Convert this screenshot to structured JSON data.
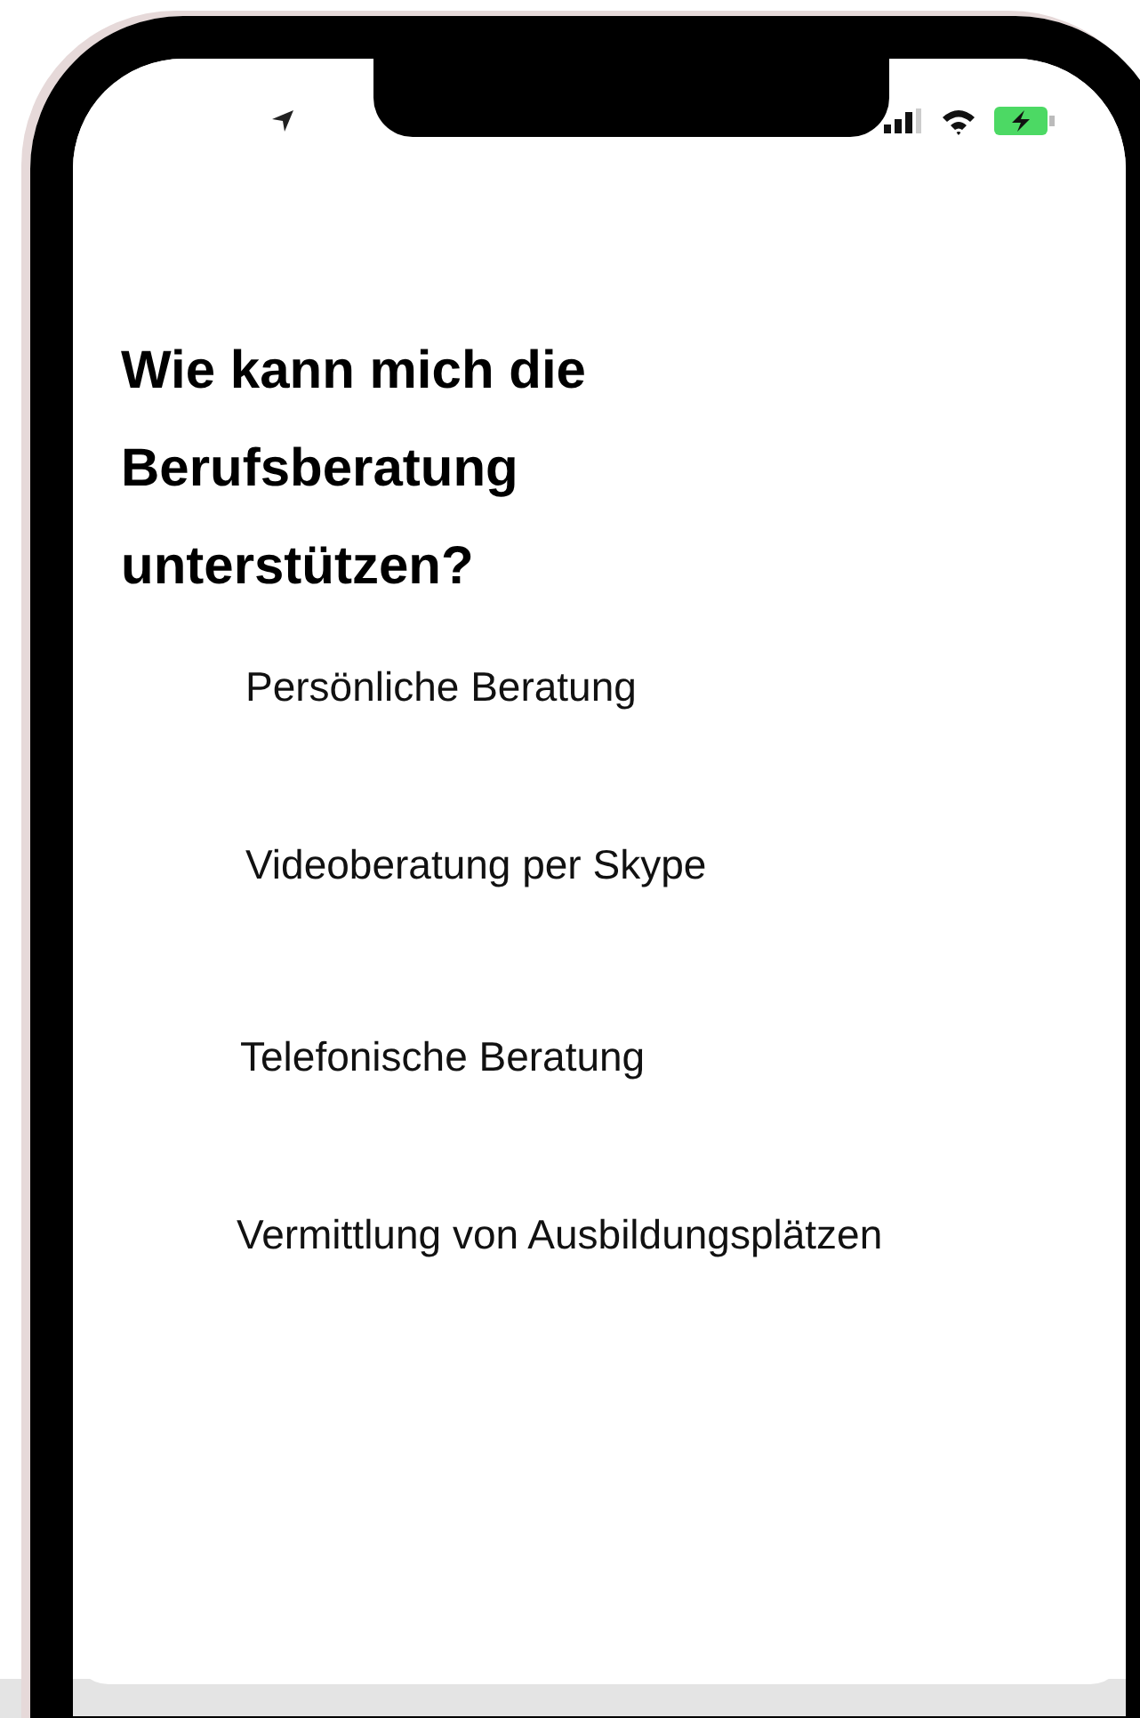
{
  "title": "Wie kann mich die Berufsberatung unterstützen?",
  "options": [
    "Persönliche Beratung",
    "Videoberatung per Skype",
    "Telefonische Beratung",
    "Vermittlung von Ausbildungsplätzen"
  ]
}
